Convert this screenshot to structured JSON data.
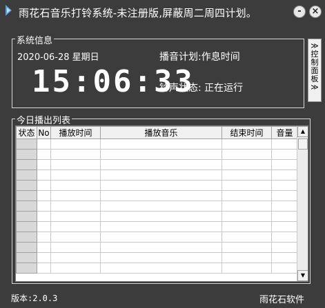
{
  "window": {
    "title": "雨花石音乐打铃系统-未注册版,屏蔽周二周四计划。",
    "minimize_label": "-",
    "close_label": "×"
  },
  "system_info": {
    "group_label": "系统信息",
    "date": "2020-06-28  星期日",
    "time": "15:06:33",
    "plan_label": "播音计划:作息时间",
    "ring_status": "铃声状态: 正在运行"
  },
  "control_panel": {
    "chars": [
      "≫",
      "控",
      "制",
      "面",
      "板",
      "≫"
    ]
  },
  "today_list": {
    "group_label": "今日播出列表",
    "columns": [
      "状态",
      "No",
      "播放时间",
      "播放音乐",
      "结束时间",
      "音量"
    ],
    "rows": [
      [
        "",
        "",
        "",
        "",
        "",
        ""
      ],
      [
        "",
        "",
        "",
        "",
        "",
        ""
      ],
      [
        "",
        "",
        "",
        "",
        "",
        ""
      ],
      [
        "",
        "",
        "",
        "",
        "",
        ""
      ],
      [
        "",
        "",
        "",
        "",
        "",
        ""
      ],
      [
        "",
        "",
        "",
        "",
        "",
        ""
      ],
      [
        "",
        "",
        "",
        "",
        "",
        ""
      ],
      [
        "",
        "",
        "",
        "",
        "",
        ""
      ],
      [
        "",
        "",
        "",
        "",
        "",
        ""
      ],
      [
        "",
        "",
        "",
        "",
        "",
        ""
      ],
      [
        "",
        "",
        "",
        "",
        "",
        ""
      ],
      [
        "",
        "",
        "",
        "",
        "",
        ""
      ],
      [
        "",
        "",
        "",
        "",
        "",
        ""
      ]
    ]
  },
  "scrollbar": {
    "up_icon": "▲",
    "down_icon": "▼"
  },
  "footer": {
    "version": "版本:2.0.3",
    "company": "雨花石软件"
  }
}
